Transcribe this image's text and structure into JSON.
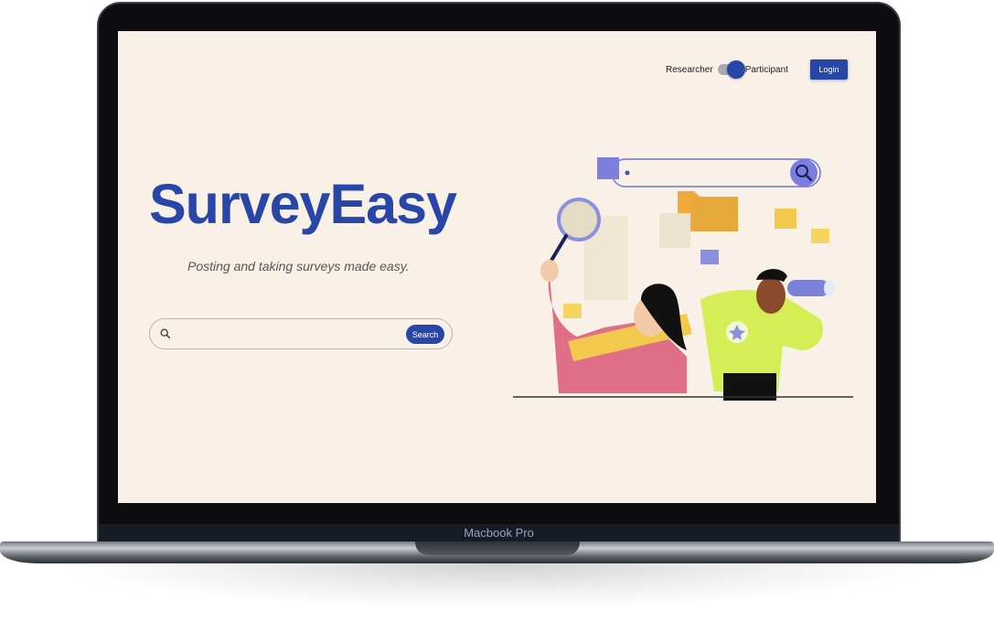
{
  "device": {
    "model_label": "Macbook Pro"
  },
  "header": {
    "toggle": {
      "left_label": "Researcher",
      "right_label": "Participant",
      "selected": "Participant"
    },
    "login_label": "Login"
  },
  "hero": {
    "brand": "SurveyEasy",
    "tagline": "Posting and taking surveys made easy."
  },
  "search": {
    "button_label": "Search",
    "value": "",
    "placeholder": ""
  },
  "colors": {
    "accent": "#2846a8",
    "background": "#f9f1e8"
  },
  "icons": {
    "search": "search-icon",
    "illustration": "survey-illustration"
  }
}
